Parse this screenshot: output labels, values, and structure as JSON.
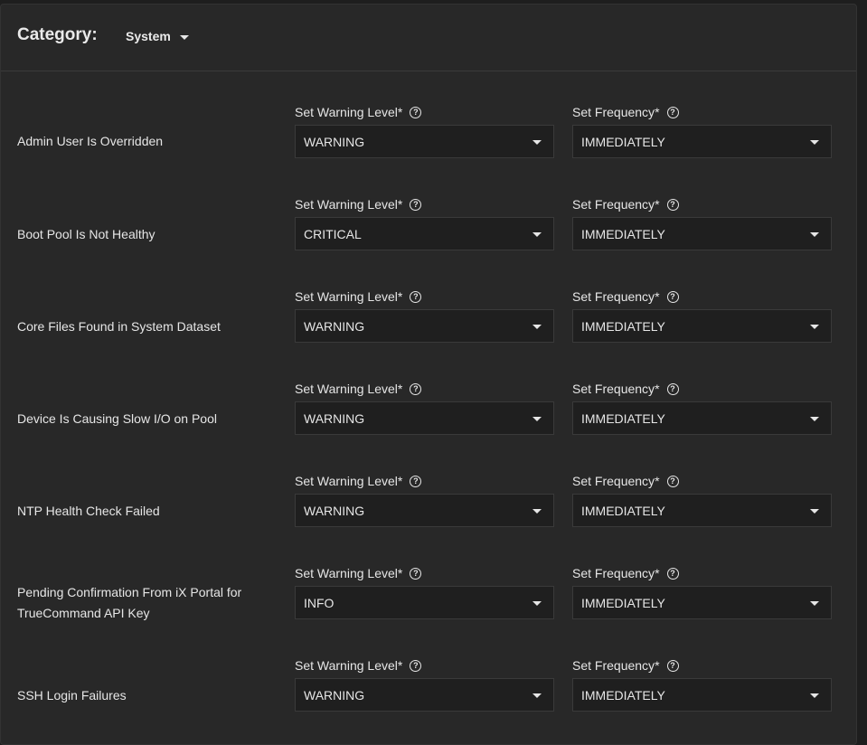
{
  "category": {
    "label": "Category:",
    "value": "System"
  },
  "fields": {
    "warning_label": "Set Warning Level",
    "frequency_label": "Set Frequency",
    "required_mark": "*",
    "help": "?"
  },
  "alerts": [
    {
      "name": "Admin User Is Overridden",
      "level": "WARNING",
      "frequency": "IMMEDIATELY"
    },
    {
      "name": "Boot Pool Is Not Healthy",
      "level": "CRITICAL",
      "frequency": "IMMEDIATELY"
    },
    {
      "name": "Core Files Found in System Dataset",
      "level": "WARNING",
      "frequency": "IMMEDIATELY"
    },
    {
      "name": "Device Is Causing Slow I/O on Pool",
      "level": "WARNING",
      "frequency": "IMMEDIATELY"
    },
    {
      "name": "NTP Health Check Failed",
      "level": "WARNING",
      "frequency": "IMMEDIATELY"
    },
    {
      "name": "Pending Confirmation From iX Portal for TrueCommand API Key",
      "level": "INFO",
      "frequency": "IMMEDIATELY"
    },
    {
      "name": "SSH Login Failures",
      "level": "WARNING",
      "frequency": "IMMEDIATELY"
    }
  ]
}
